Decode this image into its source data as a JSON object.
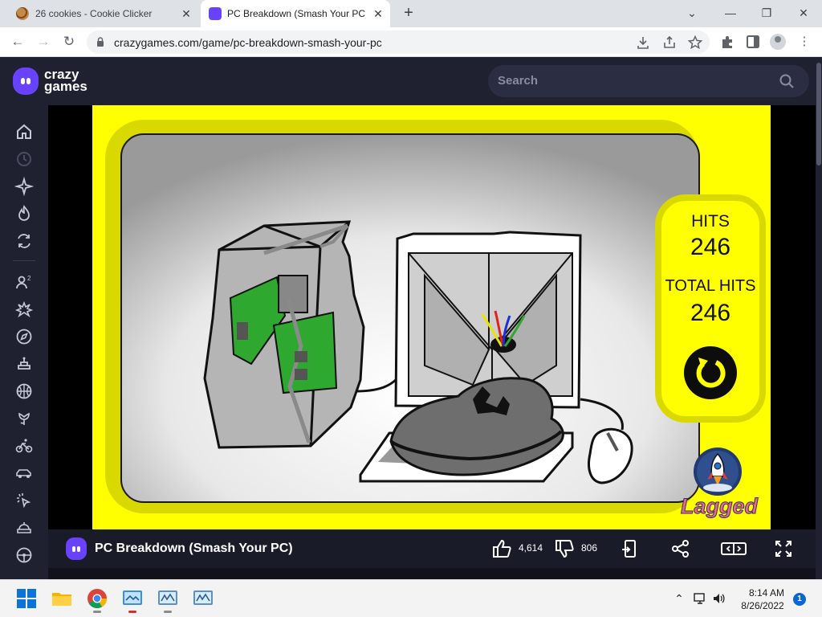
{
  "browser": {
    "tabs": [
      {
        "title": "26 cookies - Cookie Clicker",
        "active": false
      },
      {
        "title": "PC Breakdown (Smash Your PC) on CrazyGames",
        "active": true
      }
    ],
    "new_tab": "+",
    "window_controls": {
      "dropdown": "⌄",
      "minimize": "—",
      "restore": "❐",
      "close": "✕"
    },
    "nav": {
      "back": "←",
      "forward": "→",
      "reload": "↻"
    },
    "url": "crazygames.com/game/pc-breakdown-smash-your-pc",
    "icons": [
      "download-icon",
      "share-icon",
      "star-icon",
      "extensions-icon",
      "sidepanel-icon",
      "profile-icon",
      "menu-icon"
    ]
  },
  "site": {
    "logo_line1": "crazy",
    "logo_line2": "games",
    "search_placeholder": "Search",
    "brand_color": "#6842ff",
    "sidebar_icons": [
      "home-icon",
      "recent-icon",
      "new-icon",
      "trending-icon",
      "updated-icon",
      "multiplayer-icon",
      "action-icon",
      "adventure-icon",
      "casual-icon",
      "basketball-icon",
      "flower-icon",
      "bike-icon",
      "car-icon",
      "clicker-icon",
      "cooking-icon",
      "driving-icon"
    ]
  },
  "game": {
    "hits_label": "HITS",
    "hits_value": "246",
    "total_hits_label": "TOTAL HITS",
    "total_hits_value": "246",
    "restart_icon": "restart-icon",
    "publisher_logo": "Lagged",
    "background_color": "#ffff00"
  },
  "info_bar": {
    "title": "PC Breakdown (Smash Your PC)",
    "likes": "4,614",
    "dislikes": "806",
    "icons": [
      "thumbs-up-icon",
      "thumbs-down-icon",
      "report-icon",
      "share-icon",
      "theater-mode-icon",
      "fullscreen-icon"
    ]
  },
  "taskbar": {
    "time": "8:14 AM",
    "date": "8/26/2022",
    "notifications": "1",
    "apps": [
      "windows-start-icon",
      "file-explorer-icon",
      "chrome-icon",
      "app-icon-1",
      "app-icon-2",
      "app-icon-3"
    ]
  }
}
